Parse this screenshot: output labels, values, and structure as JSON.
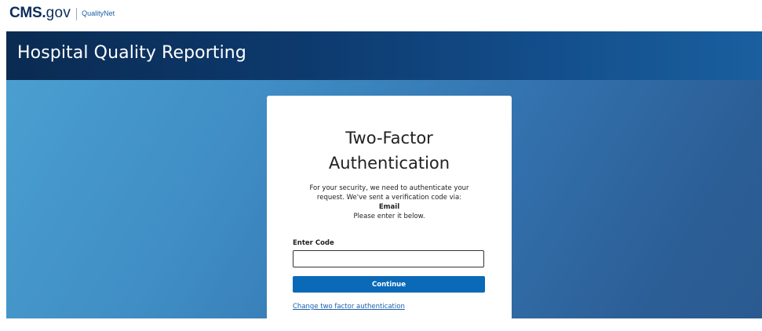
{
  "brand": {
    "cms": "CMS",
    "dot": ".",
    "gov": "gov",
    "product": "QualityNet"
  },
  "header": {
    "title": "Hospital Quality Reporting"
  },
  "card": {
    "title_line1": "Two-Factor",
    "title_line2": "Authentication",
    "desc_line1": "For your security, we need to authenticate your",
    "desc_line2": "request. We've sent a verification code via:",
    "method": "Email",
    "desc_line3": "Please enter it below.",
    "code_label": "Enter Code",
    "code_value": "",
    "continue_label": "Continue",
    "change_link": "Change two factor authentication"
  },
  "colors": {
    "brand_navy": "#0b2e5c",
    "header_dark": "#0a2b52",
    "button_blue": "#0a6ab8",
    "link_blue": "#1a5faa"
  }
}
